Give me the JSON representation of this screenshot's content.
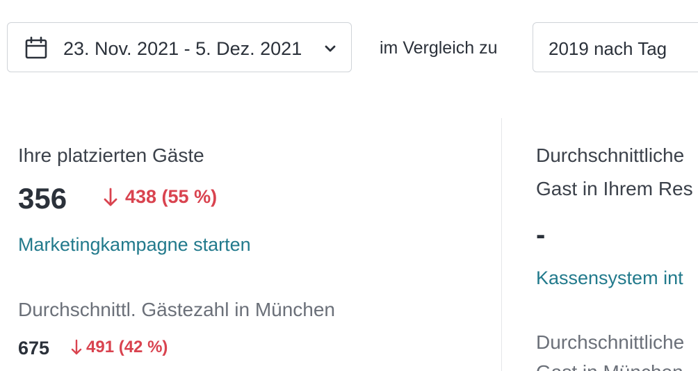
{
  "filters": {
    "date_range": "23. Nov. 2021 - 5. Dez. 2021",
    "compare_label": "im Vergleich zu",
    "compare_value": "2019 nach Tag",
    "calendar_icon": "calendar-icon",
    "chevron_icon": "chevron-down-icon"
  },
  "guests_card": {
    "title": "Ihre platzierten Gäste",
    "value": "356",
    "change": "438 (55 %)",
    "change_direction": "down",
    "link": "Marketingkampagne starten",
    "city_avg_title": "Durchschnittl. Gästezahl in München",
    "city_avg_value": "675",
    "city_avg_change": "491 (42 %)",
    "city_avg_direction": "down"
  },
  "spend_card": {
    "title_line1": "Durchschnittliche",
    "title_line2": "Gast in Ihrem Res",
    "value": "-",
    "link": "Kassensystem int",
    "sub_line1": "Durchschnittliche",
    "sub_line2": "Gast in München"
  },
  "colors": {
    "negative": "#d9434f",
    "link": "#227a8c",
    "text": "#2b313a",
    "muted": "#6b7079",
    "border": "#cfd3d8"
  }
}
